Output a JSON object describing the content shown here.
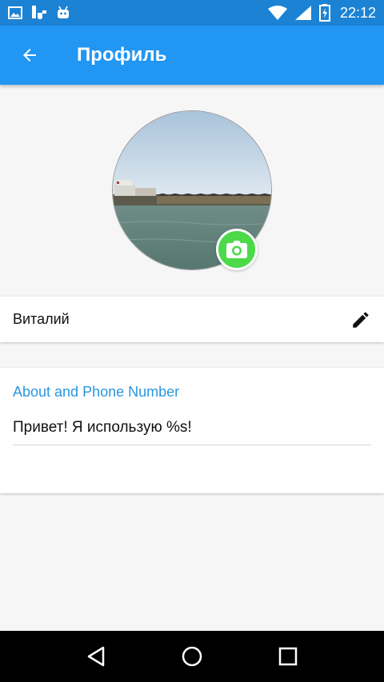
{
  "status_bar": {
    "time": "22:12",
    "icons": [
      "image-notification-icon",
      "download-notification-icon",
      "android-notification-icon",
      "wifi-icon",
      "signal-icon",
      "battery-charging-icon"
    ]
  },
  "app_bar": {
    "back_icon": "arrow-back-icon",
    "title": "Профиль"
  },
  "profile": {
    "avatar": "profile-photo",
    "camera_icon": "camera-icon",
    "camera_color": "#4cd94a"
  },
  "name_card": {
    "name": "Виталий",
    "edit_icon": "pencil-icon"
  },
  "about_card": {
    "title": "About and Phone Number",
    "status": "Привет! Я использую %s!"
  },
  "nav_bar": {
    "icons": [
      "back-triangle-icon",
      "home-circle-icon",
      "recents-square-icon"
    ]
  },
  "colors": {
    "app_bar": "#2196f3",
    "status_bar": "#1c82d4",
    "accent_text": "#2a96dc"
  }
}
